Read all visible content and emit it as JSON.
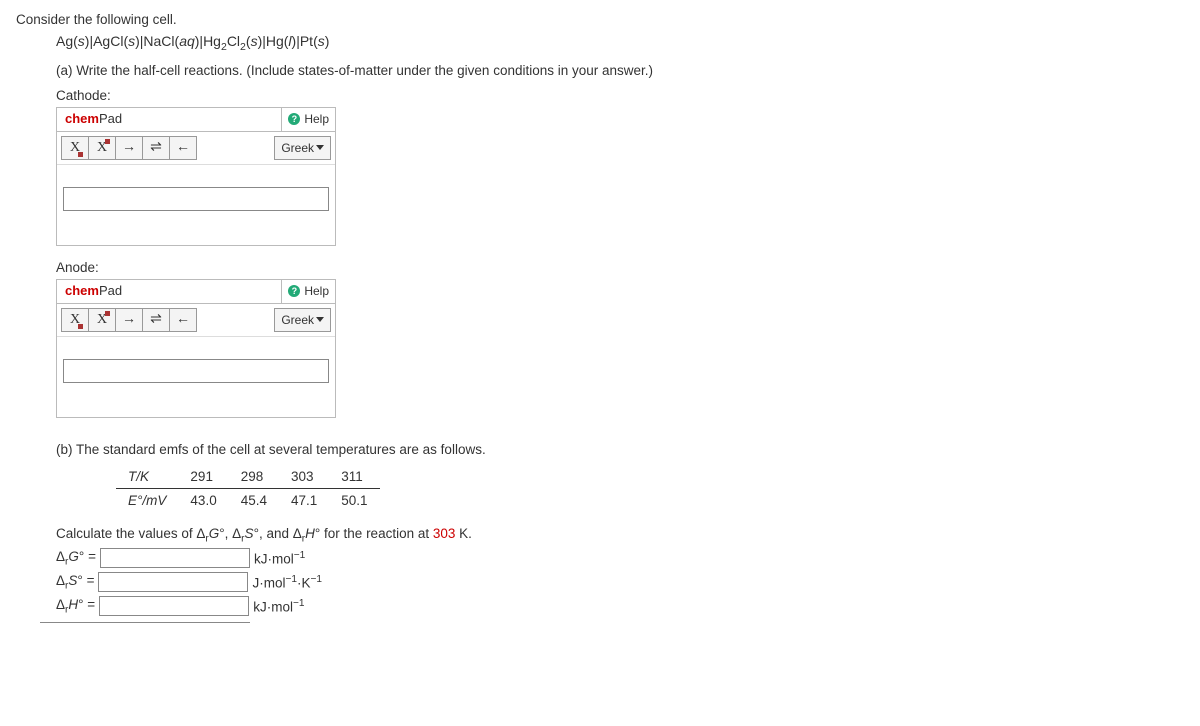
{
  "question": {
    "intro": "Consider the following cell.",
    "cell_notation": "Ag(s)|AgCl(s)|NaCl(aq)|Hg₂Cl₂(s)|Hg(l)|Pt(s)",
    "part_a_prompt": "(a) Write the half-cell reactions. (Include states-of-matter under the given conditions in your answer.)",
    "cathode_label": "Cathode:",
    "anode_label": "Anode:"
  },
  "chempad": {
    "title_chem": "chem",
    "title_pad": "Pad",
    "help": "Help",
    "greek": "Greek",
    "btn_sub": "X",
    "btn_sup": "X",
    "btn_arrow_right": "→",
    "btn_equil": "⇌",
    "btn_arrow_left": "←"
  },
  "part_b": {
    "prompt": "(b) The standard emfs of the cell at several temperatures are as follows.",
    "table": {
      "row1_label": "T/K",
      "row2_label": "E°/mV",
      "cols": [
        "291",
        "298",
        "303",
        "311"
      ],
      "vals": [
        "43.0",
        "45.4",
        "47.1",
        "50.1"
      ]
    },
    "calc_prompt_pre": "Calculate the values of Δ",
    "calc_prompt": "°, Δ",
    "calc_prompt_and": "°, and Δ",
    "calc_prompt_post": "° for the reaction at ",
    "calc_temp": "303",
    "calc_K": " K.",
    "subs": {
      "r": "r",
      "G": "G",
      "S": "S",
      "H": "H"
    },
    "labels": {
      "dg": "Δ",
      "eq": " = "
    },
    "units": {
      "kjmol": "kJ·mol",
      "jmolk": "J·mol",
      "neg1": "−1",
      "kneg1": "·K"
    }
  },
  "chart_data": {
    "type": "table",
    "title": "Standard emfs of the cell at several temperatures",
    "columns": [
      "T/K",
      "E°/mV"
    ],
    "rows": [
      [
        291,
        43.0
      ],
      [
        298,
        45.4
      ],
      [
        303,
        47.1
      ],
      [
        311,
        50.1
      ]
    ]
  }
}
